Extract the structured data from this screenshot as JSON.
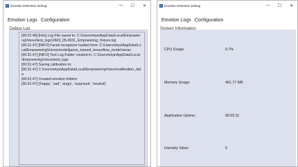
{
  "left_window": {
    "title": "Emotion Detection Debug",
    "controls": {
      "minimize": "—",
      "maximize": "☐",
      "close": "✕"
    },
    "tabs": [
      "Emotion Logs",
      "Configuration"
    ],
    "subtab": "Debug Log",
    "log_text": "[00:31:46] [Info] Log File saved to: C:\\Users\\etya\\AppData\\Local\\EmpoweringVoices\\text_logs\\2603_05-0031_Empowering_Voices.log\n[00:31:47] [INFO] Facial recognizer loaded from: C:\\Users\\etya\\AppData\\Local\\EmpoweringVoices\\model\\jason_trained_tensorflow_model.keras\n[00:31:47] [INFO] Text Log Folder created in: C:\\Users\\etya\\AppData\\Local\\EmpoweringVoices\\text_logs\n[00:31:47] Saving calibration to:\n[00:31:47] C:\\Users\\etya\\AppData\\Local\\EmpoweringVoices\\calibration_data\n[00:31:47] Created emotion folders:\n[00:31:47] ['happy', 'sad', 'angry', 'surprised', 'neutral']"
  },
  "right_window": {
    "title": "Emotion Detection Debug",
    "controls": {
      "minimize": "—",
      "maximize": "☐",
      "close": "✕"
    },
    "tabs": [
      "Emotion Logs",
      "Configuration"
    ],
    "subtab": "System Information",
    "metrics": {
      "cpu_label": "CPU Usage:",
      "cpu_value": "0.7%",
      "memory_label": "Memory Usage:",
      "memory_value": "461.77 MB",
      "uptime_label": "Application Uptime:",
      "uptime_value": "00:03:11",
      "intensity_label": "Intensity Value:",
      "intensity_value": "0"
    }
  },
  "colors": {
    "panel_bg": "#dee1ee",
    "log_bg": "#e1e3ef",
    "app_icon": "#4a86c8"
  }
}
